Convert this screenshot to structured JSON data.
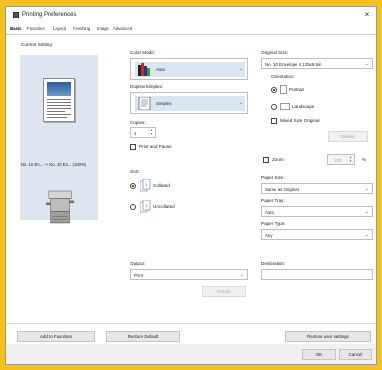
{
  "window": {
    "title": "Printing Preferences",
    "close_glyph": "×"
  },
  "tabs": [
    "Basic",
    "Favorites",
    "Layout",
    "Finishing",
    "Image",
    "Advanced"
  ],
  "left": {
    "heading": "Current Setting",
    "size_summary": "No. 10 En... -> No. 10 En... (100%)"
  },
  "color_mode": {
    "label": "Color Mode:",
    "value": "Auto"
  },
  "duplex": {
    "label": "Duplex/Simplex:",
    "value": "Simplex"
  },
  "copies": {
    "label": "Copies:",
    "value": "1"
  },
  "print_pause": {
    "label": "Print and Pause",
    "checked": false
  },
  "sort": {
    "label": "Sort:",
    "options": [
      {
        "label": "Collated",
        "selected": true
      },
      {
        "label": "Uncollated",
        "selected": false
      }
    ]
  },
  "output": {
    "label": "Output:",
    "value": "Print",
    "details_label": "Details"
  },
  "original_size": {
    "label": "Original Size:",
    "value": "No. 10 Envelope 4.125x9.5in"
  },
  "orientation": {
    "label": "Orientation:",
    "options": [
      {
        "label": "Portrait",
        "selected": true
      },
      {
        "label": "Landscape",
        "selected": false
      }
    ]
  },
  "mixed_size": {
    "label": "Mixed Size Original",
    "details_label": "Details",
    "checked": false
  },
  "zoom": {
    "label": "Zoom",
    "value": "100",
    "unit": "%",
    "checked": false
  },
  "paper_size": {
    "label": "Paper Size:",
    "value": "Same as Original"
  },
  "paper_tray": {
    "label": "Paper Tray:",
    "value": "Auto"
  },
  "paper_type": {
    "label": "Paper Type:",
    "value": "Any"
  },
  "destination": {
    "label": "Destination:",
    "value": ""
  },
  "footer": {
    "add_favorites": "Add to Favorites",
    "restore_default": "Restore Default",
    "restore_user": "Restore user settings",
    "ok": "OK",
    "cancel": "Cancel"
  },
  "colors": {
    "background": "#f5c21b",
    "preview_bg": "#dde5f1",
    "selection": "#d9e5f3"
  },
  "icons": [
    "printer-app-icon",
    "close-icon",
    "document-preview-icon",
    "printer-device-icon",
    "color-mode-icon",
    "simplex-icon",
    "collated-icon",
    "uncollated-icon",
    "portrait-icon",
    "landscape-icon",
    "dropdown-arrow-icon",
    "spinner-icon"
  ]
}
